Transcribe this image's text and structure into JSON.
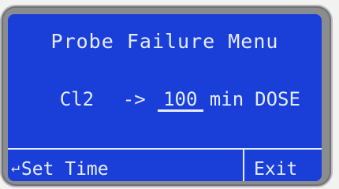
{
  "menu": {
    "title": "Probe Failure Menu"
  },
  "setting": {
    "probe": "Cl2",
    "arrow": "->",
    "value": "100",
    "unit": "min",
    "action": "DOSE"
  },
  "softkeys": {
    "left_icon": "enter-icon",
    "left_label": "Set Time",
    "right_label": "Exit"
  },
  "colors": {
    "screen": "#1a3fd8",
    "text": "#e6ecff"
  }
}
